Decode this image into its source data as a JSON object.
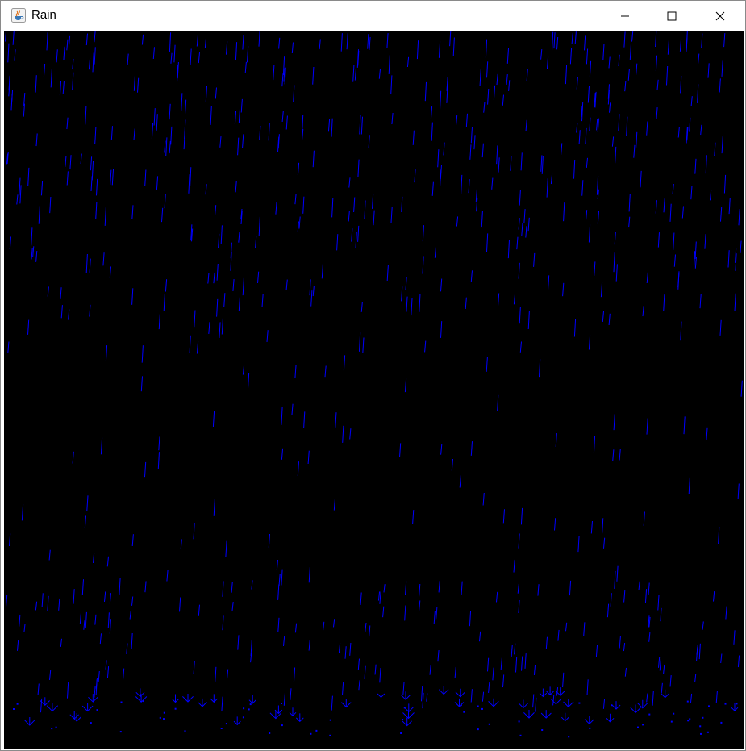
{
  "window": {
    "title": "Rain",
    "app_icon": "java-coffee-cup-icon",
    "controls": [
      "minimize-icon",
      "maximize-icon",
      "close-icon"
    ]
  },
  "scene": {
    "background": "#000000",
    "drop_color": "#0000ff",
    "description_free": true
  }
}
